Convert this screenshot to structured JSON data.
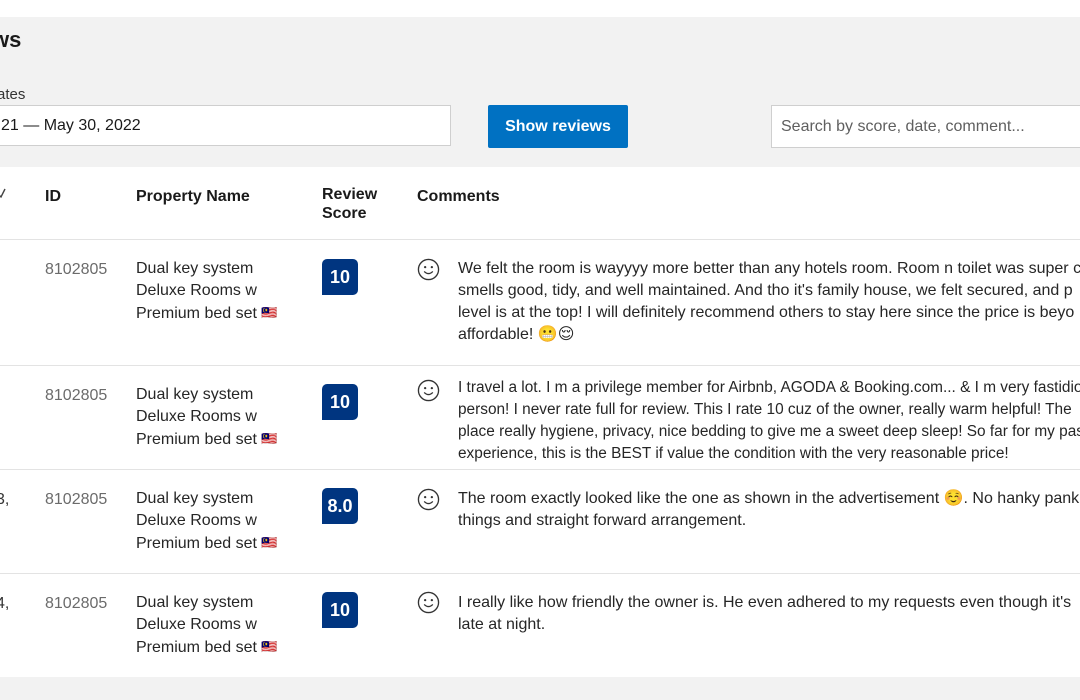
{
  "header": {
    "title": "ws"
  },
  "filters": {
    "dates_label": "ates",
    "date_range_value": "21 — May 30, 2022",
    "show_button": "Show reviews",
    "search_placeholder": "Search by score, date, comment..."
  },
  "table": {
    "columns": [
      "ID",
      "Property Name",
      "Review Score",
      "Comments"
    ],
    "rows": [
      {
        "date": "",
        "id": "8102805",
        "property": "Dual key system Deluxe Rooms w Premium bed set",
        "score": "10",
        "comment": "We felt the room is wayyyy more better than any hotels room. Room n toilet was super c smells good, tidy, and well maintained. And tho it's family house, we felt secured, and p level is at the top! I will definitely recommend others to stay here since the price is beyo affordable! 😬😌"
      },
      {
        "date": ",",
        "id": "8102805",
        "property": "Dual key system Deluxe Rooms w Premium bed set",
        "score": "10",
        "comment": "I travel a lot. I m a privilege member for Airbnb, AGODA & Booking.com... & I m very fastidio person! I never rate full for review. This I rate 10 cuz of the owner, really warm helpful! The place really hygiene, privacy, nice bedding to give me a sweet deep sleep! So far for my pas experience, this is the BEST if value the condition with the very reasonable price!"
      },
      {
        "date": "3,",
        "id": "8102805",
        "property": "Dual key system Deluxe Rooms w Premium bed set",
        "score": "8.0",
        "comment": "The room exactly looked like the one as shown in the advertisement ☺️. No hanky pank of things and straight forward arrangement."
      },
      {
        "date": "4,",
        "id": "8102805",
        "property": "Dual key system Deluxe Rooms w Premium bed set",
        "score": "10",
        "comment": "I really like how friendly the owner is. He even adhered to my requests even though it's late at night."
      }
    ]
  },
  "icons": {
    "sort": "check-sort-icon",
    "sentiment": "smiley-icon",
    "flag": "malaysia-flag-icon"
  },
  "colors": {
    "primary_button": "#0071c2",
    "score_badge": "#003580"
  }
}
